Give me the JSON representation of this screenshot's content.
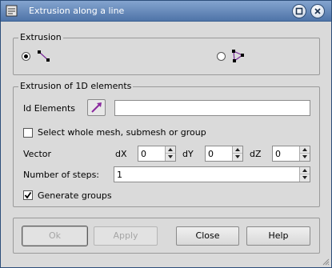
{
  "window": {
    "title": "Extrusion along a line",
    "title_icon": "app-icon",
    "controls": [
      "minimize-icon",
      "close-icon"
    ]
  },
  "extrusion_group": {
    "title": "Extrusion",
    "modes": [
      {
        "icon": "edge-mode-icon",
        "selected": true
      },
      {
        "icon": "face-mode-icon",
        "selected": false
      }
    ]
  },
  "elements_group": {
    "title": "Extrusion of 1D elements",
    "id_elements_label": "Id Elements",
    "id_elements_value": "",
    "select_whole_mesh_label": "Select whole mesh, submesh or group",
    "select_whole_mesh_checked": false,
    "vector_label": "Vector",
    "dx_label": "dX",
    "dx_value": "0",
    "dy_label": "dY",
    "dy_value": "0",
    "dz_label": "dZ",
    "dz_value": "0",
    "steps_label": "Number of steps:",
    "steps_value": "1",
    "generate_groups_label": "Generate groups",
    "generate_groups_checked": true
  },
  "buttons": {
    "ok": "Ok",
    "apply": "Apply",
    "close": "Close",
    "help": "Help"
  },
  "colors": {
    "titlebar": "#4f74a8",
    "dialog_bg": "#dadada",
    "selection_arrow": "#8a2a9e"
  }
}
